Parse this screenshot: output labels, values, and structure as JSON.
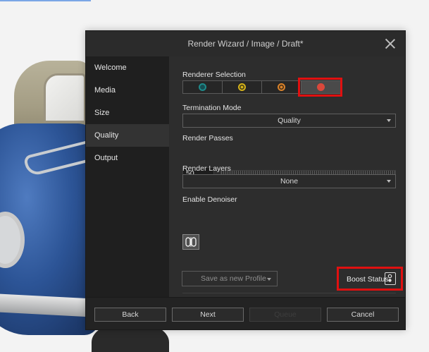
{
  "dialog": {
    "title": "Render Wizard / Image / Draft*"
  },
  "sidebar": {
    "items": [
      {
        "label": "Welcome"
      },
      {
        "label": "Media"
      },
      {
        "label": "Size"
      },
      {
        "label": "Quality"
      },
      {
        "label": "Output"
      }
    ],
    "active": "Quality"
  },
  "quality": {
    "renderer_selection_label": "Renderer Selection",
    "renderers": [
      {
        "icon": "renderer-teal-icon",
        "color": "#1e8a8a"
      },
      {
        "icon": "renderer-yellow-icon",
        "color": "#d4b21a"
      },
      {
        "icon": "renderer-orange-icon",
        "color": "#d9822b"
      },
      {
        "icon": "renderer-red-icon",
        "color": "#d9483b"
      }
    ],
    "selected_renderer_index": 3,
    "termination_mode_label": "Termination Mode",
    "termination_mode_value": "Quality",
    "render_passes_label": "Render Passes",
    "render_passes_value": "50",
    "render_layers_label": "Render Layers",
    "render_layers_value": "None",
    "enable_denoiser_label": "Enable Denoiser"
  },
  "actions": {
    "save_profile_label": "Save as new Profile",
    "boost_status_label": "Boost Status"
  },
  "footer": {
    "back_label": "Back",
    "next_label": "Next",
    "queue_label": "Queue",
    "cancel_label": "Cancel"
  },
  "colors": {
    "highlight": "#e01010",
    "dialog_bg": "#2b2b2b",
    "sidebar_bg": "#1f1f1f"
  }
}
